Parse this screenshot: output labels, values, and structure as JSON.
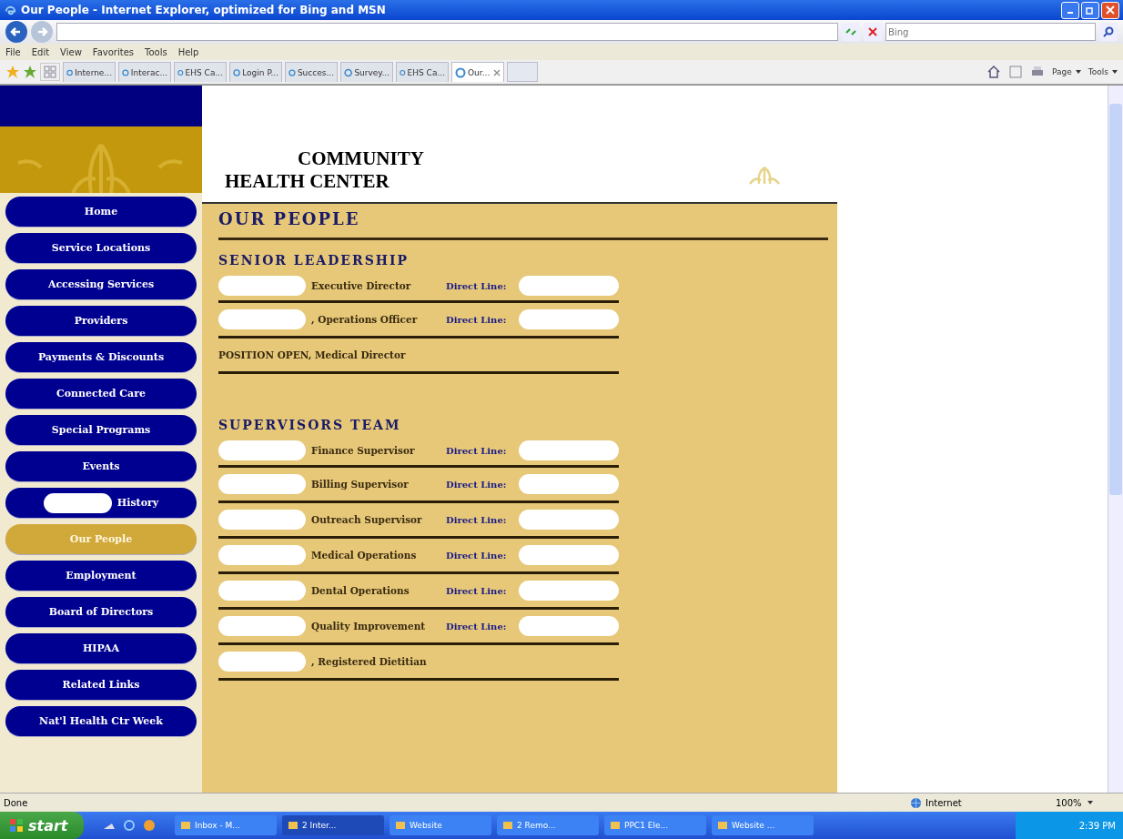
{
  "window": {
    "title": "Our People - Internet Explorer, optimized for Bing and MSN"
  },
  "search": {
    "placeholder": "Bing"
  },
  "menu": [
    "File",
    "Edit",
    "View",
    "Favorites",
    "Tools",
    "Help"
  ],
  "tabs": [
    {
      "label": "Interne...",
      "selected": false
    },
    {
      "label": "Interac...",
      "selected": false
    },
    {
      "label": "EHS Ca...",
      "selected": false
    },
    {
      "label": "Login P...",
      "selected": false
    },
    {
      "label": "Succes...",
      "selected": false
    },
    {
      "label": "Survey...",
      "selected": false
    },
    {
      "label": "EHS Ca...",
      "selected": false
    },
    {
      "label": "Our...",
      "selected": true
    }
  ],
  "command_bar": [
    "Page",
    "Tools"
  ],
  "site": {
    "title_line_1": "COMMUNITY",
    "title_line_2": "HEALTH CENTER"
  },
  "nav": [
    {
      "label": "Home",
      "selected": false
    },
    {
      "label": "Service Locations",
      "selected": false
    },
    {
      "label": "Accessing Services",
      "selected": false
    },
    {
      "label": "Providers",
      "selected": false
    },
    {
      "label": "Payments & Discounts",
      "selected": false
    },
    {
      "label": "Connected Care",
      "selected": false
    },
    {
      "label": "Special Programs",
      "selected": false
    },
    {
      "label": "Events",
      "selected": false
    },
    {
      "label": "History",
      "selected": false
    },
    {
      "label": "Our People",
      "selected": true
    },
    {
      "label": "Employment",
      "selected": false
    },
    {
      "label": "Board of Directors",
      "selected": false
    },
    {
      "label": "HIPAA",
      "selected": false
    },
    {
      "label": "Related Links",
      "selected": false
    },
    {
      "label": "Nat'l Health Ctr Week",
      "selected": false
    }
  ],
  "page_title": "OUR PEOPLE",
  "sections": [
    {
      "heading": "SENIOR LEADERSHIP",
      "rows": [
        {
          "kind": "contact",
          "role": "Executive Director",
          "phone_label": "Direct Line:"
        },
        {
          "kind": "contact",
          "role": ", Operations Officer",
          "phone_label": "Direct Line:"
        },
        {
          "kind": "plain",
          "role": "POSITION OPEN, Medical Director"
        }
      ]
    },
    {
      "heading": "SUPERVISORS TEAM",
      "rows": [
        {
          "kind": "contact",
          "role": "Finance Supervisor",
          "phone_label": "Direct Line:"
        },
        {
          "kind": "contact",
          "role": "Billing Supervisor",
          "phone_label": "Direct Line:"
        },
        {
          "kind": "contact",
          "role": "Outreach Supervisor",
          "phone_label": "Direct Line:"
        },
        {
          "kind": "contact",
          "role": "Medical Operations",
          "phone_label": "Direct Line:"
        },
        {
          "kind": "contact",
          "role": "Dental Operations",
          "phone_label": "Direct Line:"
        },
        {
          "kind": "contact",
          "role": "Quality Improvement",
          "phone_label": "Direct Line:"
        },
        {
          "kind": "redacted",
          "role": ", Registered Dietitian"
        }
      ]
    }
  ],
  "status_bar": {
    "text": "Done",
    "zone": "Internet",
    "zoom": "100%"
  },
  "taskbar": {
    "start": "start",
    "items": [
      {
        "label": "Inbox - M...",
        "selected": false
      },
      {
        "label": "2 Inter...",
        "selected": true
      },
      {
        "label": "Website",
        "selected": false
      },
      {
        "label": "2 Remo...",
        "selected": false
      },
      {
        "label": "PPC1 Ele...",
        "selected": false
      },
      {
        "label": "Website ...",
        "selected": false
      }
    ],
    "time": "2:39 PM"
  }
}
